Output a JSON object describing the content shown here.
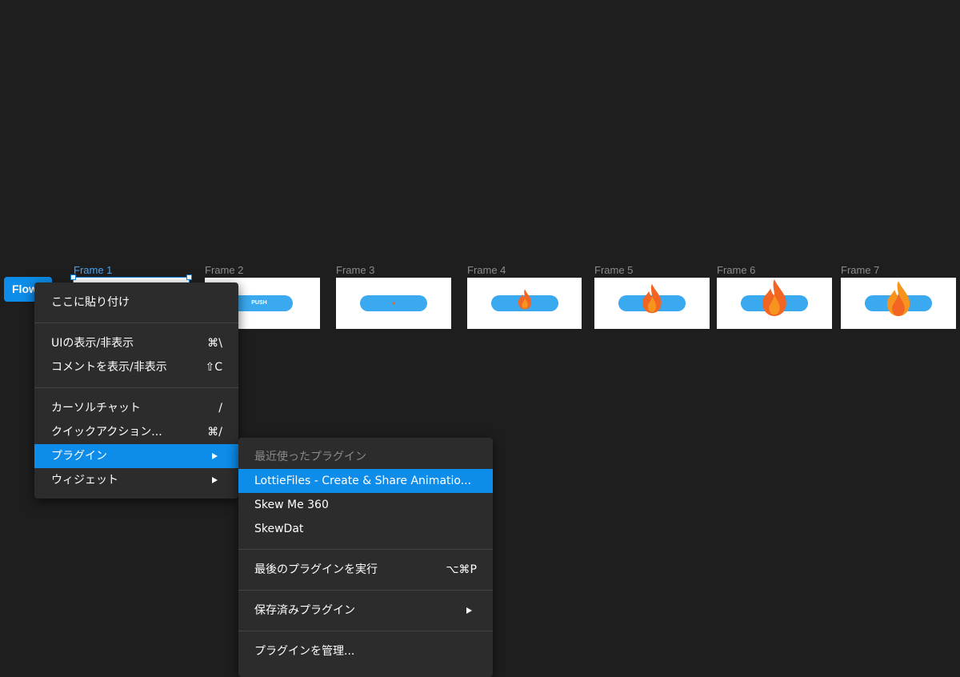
{
  "flow_badge": {
    "label": "Flow"
  },
  "frames": [
    {
      "label": "Frame 1",
      "button_text": ""
    },
    {
      "label": "Frame 2",
      "button_text": "PUSH"
    },
    {
      "label": "Frame 3",
      "button_text": ""
    },
    {
      "label": "Frame 4",
      "button_text": ""
    },
    {
      "label": "Frame 5",
      "button_text": ""
    },
    {
      "label": "Frame 6",
      "button_text": ""
    },
    {
      "label": "Frame 7",
      "button_text": ""
    }
  ],
  "context_menu": {
    "paste_here": "ここに貼り付け",
    "toggle_ui": {
      "label": "UIの表示/非表示",
      "shortcut": "⌘\\"
    },
    "toggle_comments": {
      "label": "コメントを表示/非表示",
      "shortcut": "⇧C"
    },
    "cursor_chat": {
      "label": "カーソルチャット",
      "shortcut": "/"
    },
    "quick_actions": {
      "label": "クイックアクション...",
      "shortcut": "⌘/"
    },
    "plugins": {
      "label": "プラグイン"
    },
    "widgets": {
      "label": "ウィジェット"
    }
  },
  "plugin_submenu": {
    "recent_header": "最近使ったプラグイン",
    "recent": [
      "LottieFiles - Create & Share Animatio...",
      "Skew Me 360",
      "SkewDat"
    ],
    "run_last": {
      "label": "最後のプラグインを実行",
      "shortcut": "⌥⌘P"
    },
    "saved_plugins": "保存済みプラグイン",
    "manage_plugins": "プラグインを管理..."
  },
  "colors": {
    "canvas_bg": "#1e1e1e",
    "menu_bg": "#2c2c2c",
    "accent": "#0d8ce9",
    "button_blue": "#3aa9ef",
    "flame_orange": "#f26522"
  }
}
